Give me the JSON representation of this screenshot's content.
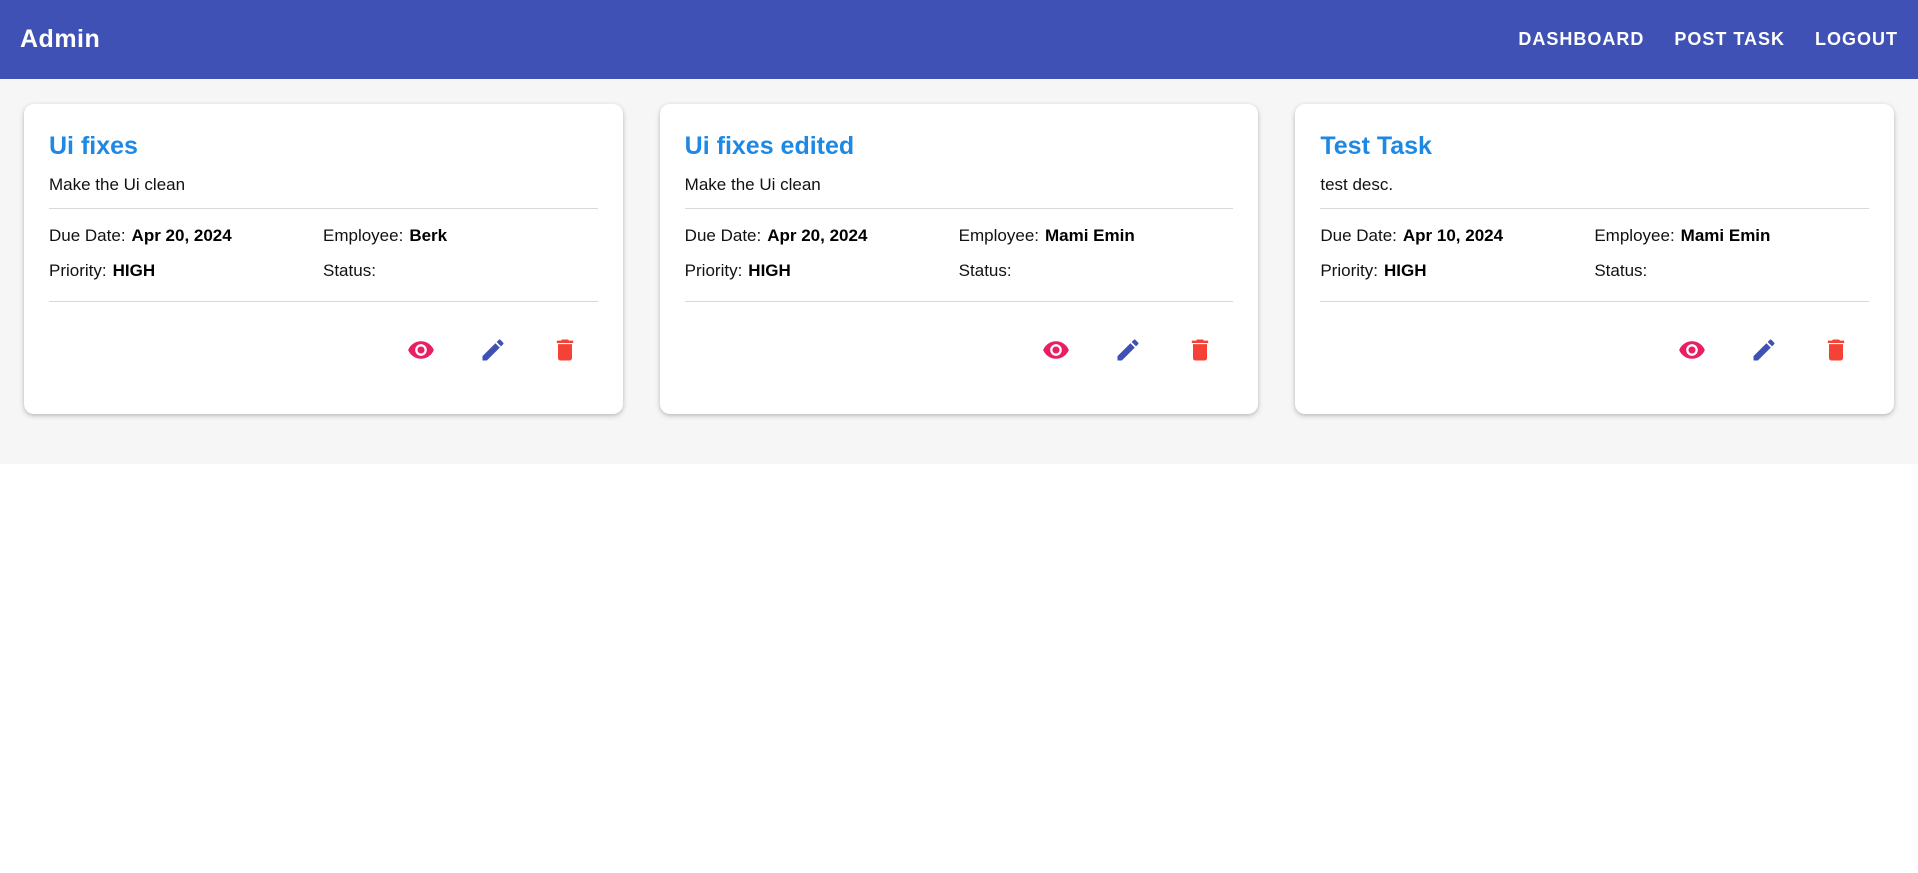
{
  "appbar": {
    "title": "Admin",
    "nav": [
      "Dashboard",
      "Post Task",
      "Logout"
    ],
    "color": "#3f51b5"
  },
  "labels": {
    "due_date": "Due Date:",
    "employee": "Employee:",
    "priority": "Priority:",
    "status": "Status:"
  },
  "tasks": [
    {
      "title": "Ui fixes",
      "description": "Make the Ui clean",
      "due_date": "Apr 20, 2024",
      "employee": "Berk",
      "priority": "HIGH",
      "status": ""
    },
    {
      "title": "Ui fixes edited",
      "description": "Make the Ui clean",
      "due_date": "Apr 20, 2024",
      "employee": "Mami Emin",
      "priority": "HIGH",
      "status": ""
    },
    {
      "title": "Test Task",
      "description": "test desc.",
      "due_date": "Apr 10, 2024",
      "employee": "Mami Emin",
      "priority": "HIGH",
      "status": ""
    }
  ],
  "icons": {
    "view": "eye-icon",
    "edit": "pencil-icon",
    "delete": "trash-icon"
  },
  "colors": {
    "title": "#1e88e5",
    "view": "#e91e63",
    "edit": "#3f51b5",
    "delete": "#f44336"
  }
}
